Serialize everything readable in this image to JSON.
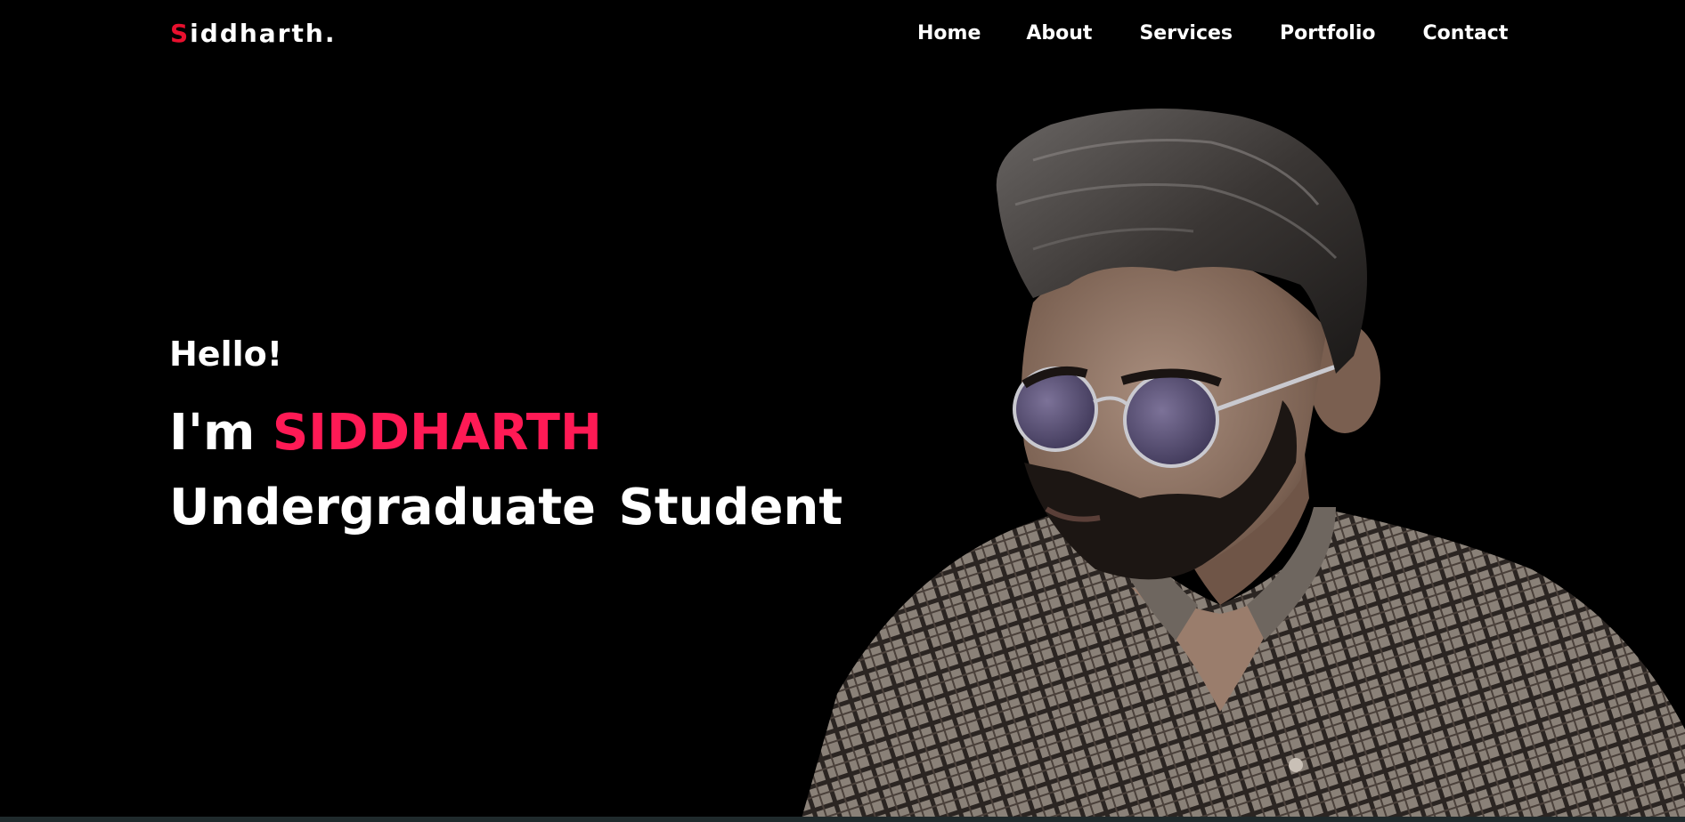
{
  "header": {
    "logo_first": "S",
    "logo_rest": "iddharth",
    "logo_dot": "."
  },
  "nav": {
    "items": [
      {
        "label": "Home"
      },
      {
        "label": "About"
      },
      {
        "label": "Services"
      },
      {
        "label": "Portfolio"
      },
      {
        "label": "Contact"
      }
    ]
  },
  "hero": {
    "greeting": "Hello!",
    "intro_prefix": "I'm",
    "name": "SIDDHARTH",
    "role": "Undergraduate Student",
    "image": "portrait-photo"
  },
  "colors": {
    "background": "#000000",
    "accent": "#ff1a55",
    "logo_accent": "#e8102e",
    "text": "#ffffff"
  }
}
